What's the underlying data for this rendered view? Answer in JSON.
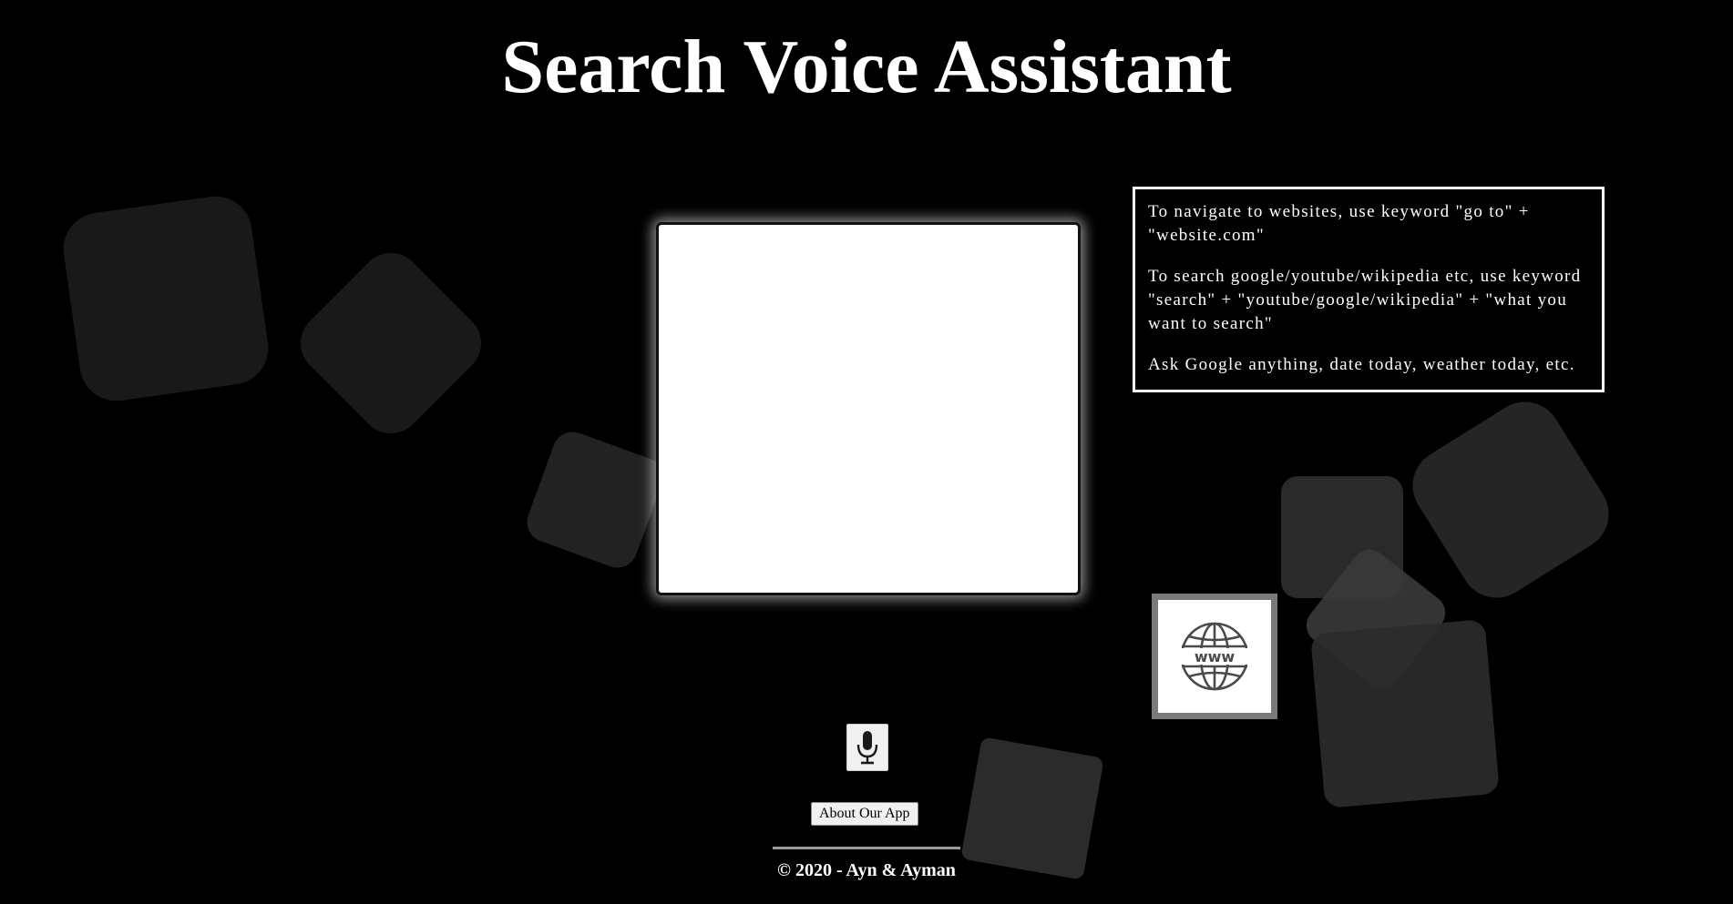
{
  "header": {
    "title": "Search Voice Assistant"
  },
  "instructions": {
    "items": [
      "To navigate to websites, use keyword \"go to\" + \"website.com\"",
      "To search google/youtube/wikipedia etc, use keyword \"search\" + \"youtube/google/wikipedia\" + \"what you want to search\"",
      "Ask Google anything, date today, weather today, etc."
    ]
  },
  "controls": {
    "www_icon": "globe-www-icon",
    "mic_icon": "microphone-icon",
    "about_label": "About Our App"
  },
  "footer": {
    "text": "© 2020 - Ayn & Ayman"
  },
  "colors": {
    "background": "#000000",
    "text": "#ffffff",
    "panel": "#ffffff",
    "www_border": "#7a7a7a"
  }
}
